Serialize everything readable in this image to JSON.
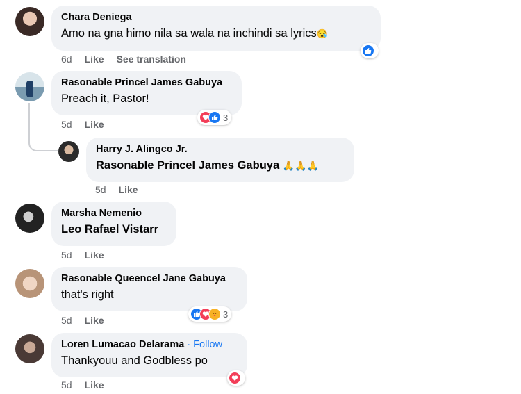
{
  "comments": [
    {
      "author": "Chara Deniega",
      "text": "Amo na gna himo nila sa wala na inchindi sa lyrics",
      "emoji": "😪",
      "time": "6d",
      "like": "Like",
      "extra": "See translation"
    },
    {
      "author": "Rasonable Princel James Gabuya",
      "text": "Preach it, Pastor!",
      "time": "5d",
      "like": "Like",
      "reaction_count": "3"
    },
    {
      "author": "Harry J. Alingco Jr.",
      "mention": "Rasonable Princel James Gabuya",
      "emoji": "🙏🙏🙏",
      "time": "5d",
      "like": "Like"
    },
    {
      "author": "Marsha Nemenio",
      "mention": "Leo Rafael Vistarr",
      "time": "5d",
      "like": "Like"
    },
    {
      "author": "Rasonable Queencel Jane Gabuya",
      "text": "that's right",
      "time": "5d",
      "like": "Like",
      "reaction_count": "3"
    },
    {
      "author": "Loren Lumacao Delarama",
      "follow": "· Follow",
      "text": "Thankyouu and Godbless po",
      "time": "5d",
      "like": "Like"
    }
  ],
  "colors": {
    "like": "#1877f2",
    "love": "#f33e58",
    "care": "#f7b125",
    "bubble": "#f0f2f5",
    "meta": "#65676b"
  }
}
